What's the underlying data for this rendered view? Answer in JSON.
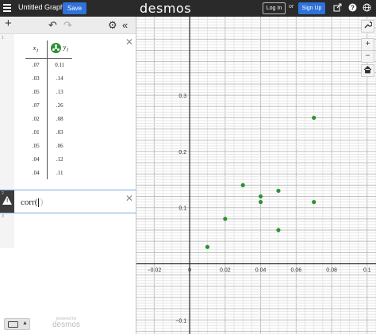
{
  "header": {
    "graph_title": "Untitled Graph",
    "save_label": "Save",
    "logo": "desmos",
    "login_label": "Log In",
    "or_label": "or",
    "signup_label": "Sign Up",
    "icons": [
      "share-icon",
      "help-icon",
      "globe-icon"
    ]
  },
  "expression_toolbar": {
    "add_label": "+",
    "undo_label": "↶",
    "redo_label": "↷",
    "settings_label": "⚙",
    "collapse_label": "«"
  },
  "expressions": [
    {
      "row_number": "1",
      "type": "table",
      "columns": [
        "x",
        "y"
      ],
      "column_subscripts": [
        "1",
        "1"
      ],
      "rows": [
        [
          ".07",
          "0.11"
        ],
        [
          ".03",
          ".14"
        ],
        [
          ".05",
          ".13"
        ],
        [
          ".07",
          ".26"
        ],
        [
          ".02",
          ".08"
        ],
        [
          ".01",
          ".03"
        ],
        [
          ".05",
          ".06"
        ],
        [
          ".04",
          ".12"
        ],
        [
          ".04",
          ".11"
        ]
      ],
      "point_color": "#2d9130"
    },
    {
      "row_number": "2",
      "type": "expression",
      "latex_display": "corr(",
      "ghost_paren": ")",
      "has_warning": true
    },
    {
      "row_number": "3",
      "type": "empty"
    }
  ],
  "footer": {
    "powered_by": "powered by",
    "brand": "desmos"
  },
  "graph_controls": [
    "wrench-icon",
    "zoom-in",
    "zoom-out",
    "home-icon"
  ],
  "graph_control_labels": [
    "🔧",
    "+",
    "−",
    "⌂"
  ],
  "chart_data": {
    "type": "scatter",
    "x": [
      0.07,
      0.03,
      0.05,
      0.07,
      0.02,
      0.01,
      0.05,
      0.04,
      0.04
    ],
    "y": [
      0.11,
      0.14,
      0.13,
      0.26,
      0.08,
      0.03,
      0.06,
      0.12,
      0.11
    ],
    "color": "#2d9130",
    "xlim": [
      -0.03,
      0.105
    ],
    "ylim": [
      -0.125,
      0.44
    ],
    "x_ticks": [
      -0.02,
      0,
      0.02,
      0.04,
      0.06,
      0.08,
      0.1
    ],
    "x_tick_labels": [
      "−0.02",
      "0",
      "0.02",
      "0.04",
      "0.06",
      "0.08",
      "0.1"
    ],
    "y_ticks": [
      -0.1,
      0.1,
      0.2,
      0.3
    ],
    "y_tick_labels": [
      "−0.1",
      "0.1",
      "0.2",
      "0.3"
    ],
    "grid": true,
    "minor_step": 0.005,
    "major_step": 0.02
  }
}
